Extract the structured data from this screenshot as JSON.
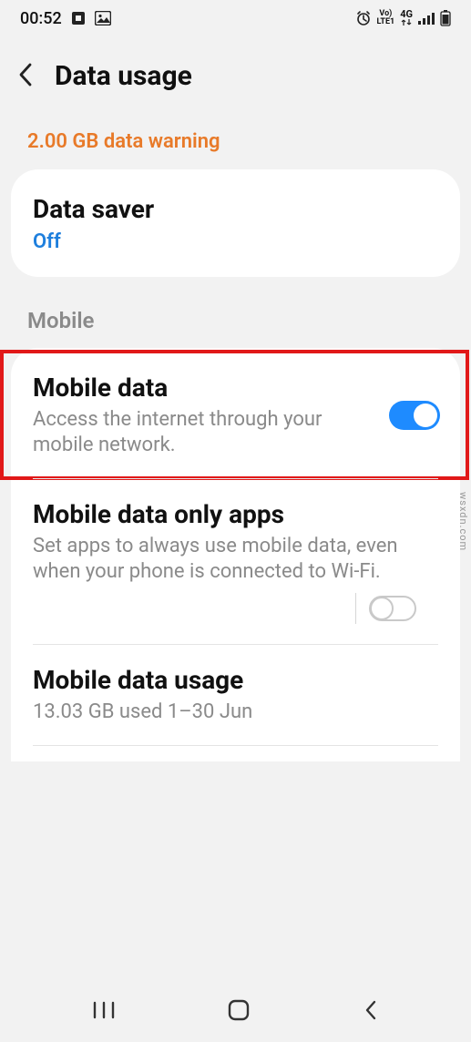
{
  "status": {
    "time": "00:52",
    "net_small_top": "Vo)",
    "net_small_bottom": "LTE1",
    "net_gen": "4G"
  },
  "header": {
    "title": "Data usage"
  },
  "warning": "2.00 GB data warning",
  "data_saver": {
    "title": "Data saver",
    "value": "Off"
  },
  "section_mobile": "Mobile",
  "mobile_data": {
    "title": "Mobile data",
    "sub": "Access the internet through your mobile network.",
    "enabled": true
  },
  "mobile_data_only_apps": {
    "title": "Mobile data only apps",
    "sub": "Set apps to always use mobile data, even when your phone is connected to Wi-Fi.",
    "enabled": false
  },
  "mobile_data_usage": {
    "title": "Mobile data usage",
    "sub": "13.03 GB used 1–30 Jun"
  },
  "watermark": "wsxdn.com"
}
